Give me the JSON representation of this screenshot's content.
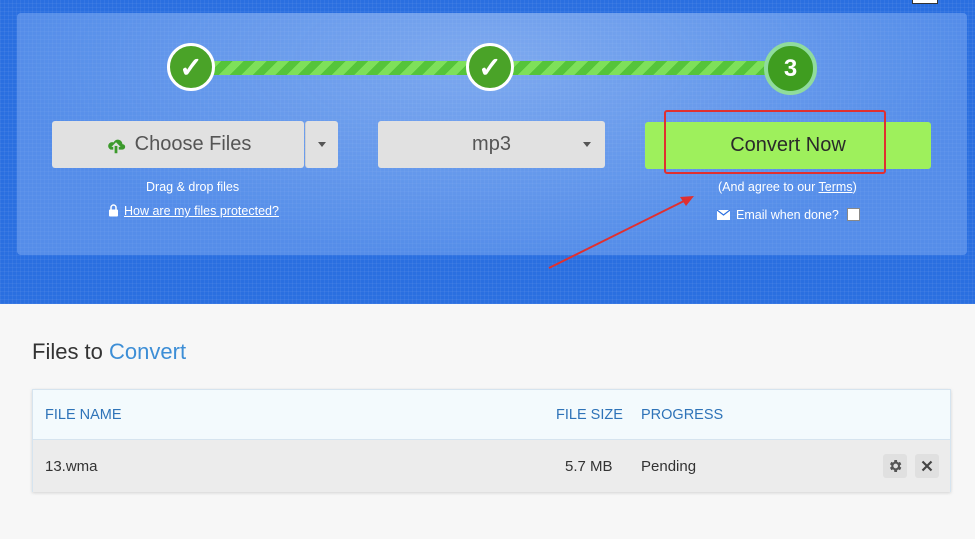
{
  "steps": [
    {
      "state": "done",
      "label": "✓"
    },
    {
      "state": "done",
      "label": "✓"
    },
    {
      "state": "current",
      "label": "3"
    }
  ],
  "choose_files": {
    "label": "Choose Files",
    "icon": "cloud-upload-icon"
  },
  "drag_drop_text": "Drag & drop files",
  "protected_link": "How are my files protected?",
  "format_select": {
    "value": "mp3"
  },
  "convert_button": "Convert Now",
  "agree_text": {
    "prefix": "(And agree to our ",
    "terms": "Terms",
    "suffix": ")"
  },
  "email_when_done": "Email when done?",
  "files_title": {
    "prefix": "Files to ",
    "accent": "Convert"
  },
  "table": {
    "columns": {
      "file_name": "FILE NAME",
      "file_size": "FILE SIZE",
      "progress": "PROGRESS"
    },
    "rows": [
      {
        "file_name": "13.wma",
        "file_size": "5.7 MB",
        "progress": "Pending"
      }
    ]
  },
  "colors": {
    "hero": "#2a6fe0",
    "step_green": "#4aa328",
    "convert_green": "#9ef05c",
    "accent_blue": "#3d8ed6",
    "annotation_red": "#e03030"
  }
}
